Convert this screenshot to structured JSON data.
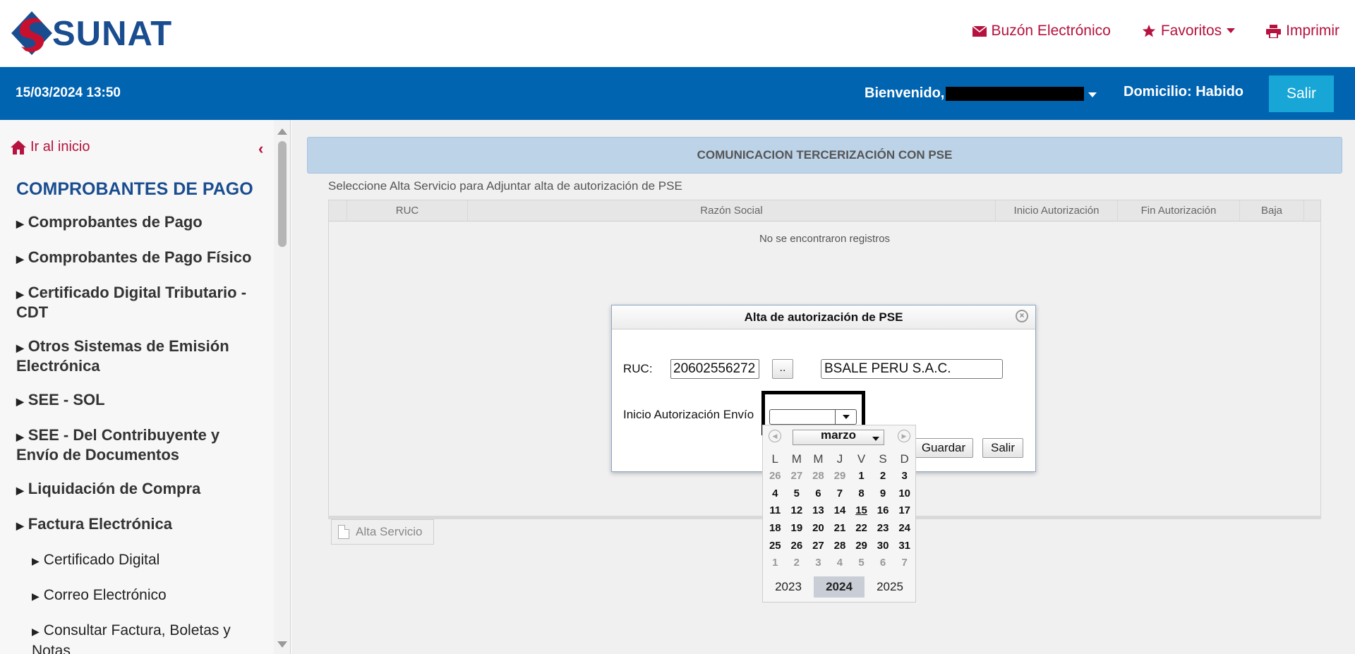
{
  "brand": {
    "name": "SUNAT"
  },
  "top_links": [
    {
      "label": "Buzón Electrónico",
      "icon": "envelope-icon"
    },
    {
      "label": "Favoritos",
      "icon": "star-icon"
    },
    {
      "label": "Imprimir",
      "icon": "printer-icon"
    }
  ],
  "bluebar": {
    "datetime": "15/03/2024 13:50",
    "welcome": "Bienvenido,",
    "domicilio": "Domicilio: Habido",
    "logout": "Salir"
  },
  "sidebar": {
    "home": "Ir al inicio",
    "title": "COMPROBANTES DE PAGO",
    "items": [
      "Comprobantes de Pago",
      "Comprobantes de Pago Físico",
      "Certificado Digital Tributario - CDT",
      "Otros Sistemas de Emisión Electrónica",
      "SEE - SOL",
      "SEE - Del Contribuyente y Envío de Documentos",
      "Liquidación de Compra",
      "Factura Electrónica"
    ],
    "subitems": [
      "Certificado Digital",
      "Correo Electrónico",
      "Consultar Factura, Boletas y Notas"
    ]
  },
  "main": {
    "title": "COMUNICACION TERCERIZACIÓN CON PSE",
    "instructions": "Seleccione Alta Servicio para Adjuntar alta de autorización de PSE",
    "columns": [
      "RUC",
      "Razón Social",
      "Inicio Autorización",
      "Fin Autorización",
      "Baja"
    ],
    "empty": "No se encontraron registros",
    "alta_button": "Alta Servicio"
  },
  "dialog": {
    "title": "Alta de autorización de PSE",
    "ruc_label": "RUC:",
    "ruc_value": "20602556272",
    "lookup_button": "..",
    "razon_social": "BSALE PERU S.A.C.",
    "inicio_label": "Inicio Autorización Envío",
    "save_button": "Guardar",
    "exit_button": "Salir"
  },
  "calendar": {
    "month": "marzo",
    "weekdays": [
      "L",
      "M",
      "M",
      "J",
      "V",
      "S",
      "D"
    ],
    "weeks": [
      [
        "26",
        "27",
        "28",
        "29",
        "1",
        "2",
        "3"
      ],
      [
        "4",
        "5",
        "6",
        "7",
        "8",
        "9",
        "10"
      ],
      [
        "11",
        "12",
        "13",
        "14",
        "15",
        "16",
        "17"
      ],
      [
        "18",
        "19",
        "20",
        "21",
        "22",
        "23",
        "24"
      ],
      [
        "25",
        "26",
        "27",
        "28",
        "29",
        "30",
        "31"
      ],
      [
        "1",
        "2",
        "3",
        "4",
        "5",
        "6",
        "7"
      ]
    ],
    "years": [
      "2023",
      "2024",
      "2025"
    ],
    "selected_year": "2024",
    "today": "15"
  }
}
